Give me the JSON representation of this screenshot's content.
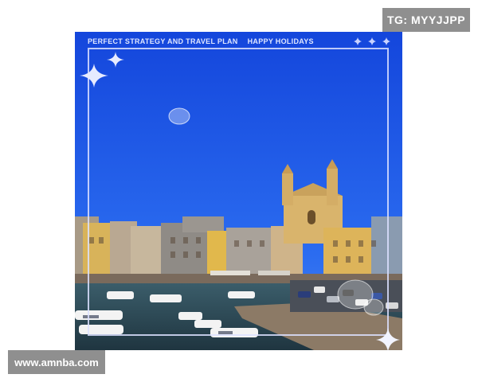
{
  "watermark": {
    "tg": "TG: MYYJJPP",
    "url": "www.amnba.com"
  },
  "overlay": {
    "strip_left": "PERFECT STRATEGY AND TRAVEL PLAN",
    "strip_right": "HAPPY HOLIDAYS"
  },
  "colors": {
    "sky": "#1a4fe0",
    "frame": "#dce1ff",
    "badge": "#8f8f8f"
  },
  "icons": [
    "sparkle-icon",
    "bubble-icon"
  ]
}
